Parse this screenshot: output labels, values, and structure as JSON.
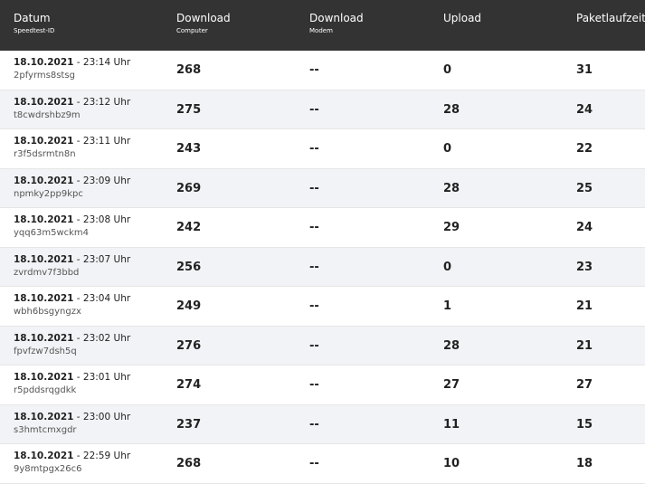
{
  "header": {
    "date": {
      "main": "Datum",
      "sub": "Speedtest-ID"
    },
    "download_computer": {
      "main": "Download",
      "sub": "Computer"
    },
    "download_modem": {
      "main": "Download",
      "sub": "Modem"
    },
    "upload": {
      "main": "Upload"
    },
    "latency": {
      "main": "Paketlaufzeit"
    }
  },
  "rows": [
    {
      "date": "18.10.2021",
      "time": "- 23:14 Uhr",
      "id": "2pfyrms8stsg",
      "download_computer": "268",
      "download_modem": "--",
      "upload": "0",
      "latency": "31"
    },
    {
      "date": "18.10.2021",
      "time": "- 23:12 Uhr",
      "id": "t8cwdrshbz9m",
      "download_computer": "275",
      "download_modem": "--",
      "upload": "28",
      "latency": "24"
    },
    {
      "date": "18.10.2021",
      "time": "- 23:11 Uhr",
      "id": "r3f5dsrmtn8n",
      "download_computer": "243",
      "download_modem": "--",
      "upload": "0",
      "latency": "22"
    },
    {
      "date": "18.10.2021",
      "time": "- 23:09 Uhr",
      "id": "npmky2pp9kpc",
      "download_computer": "269",
      "download_modem": "--",
      "upload": "28",
      "latency": "25"
    },
    {
      "date": "18.10.2021",
      "time": "- 23:08 Uhr",
      "id": "yqq63m5wckm4",
      "download_computer": "242",
      "download_modem": "--",
      "upload": "29",
      "latency": "24"
    },
    {
      "date": "18.10.2021",
      "time": "- 23:07 Uhr",
      "id": "zvrdmv7f3bbd",
      "download_computer": "256",
      "download_modem": "--",
      "upload": "0",
      "latency": "23"
    },
    {
      "date": "18.10.2021",
      "time": "- 23:04 Uhr",
      "id": "wbh6bsgyngzx",
      "download_computer": "249",
      "download_modem": "--",
      "upload": "1",
      "latency": "21"
    },
    {
      "date": "18.10.2021",
      "time": "- 23:02 Uhr",
      "id": "fpvfzw7dsh5q",
      "download_computer": "276",
      "download_modem": "--",
      "upload": "28",
      "latency": "21"
    },
    {
      "date": "18.10.2021",
      "time": "- 23:01 Uhr",
      "id": "r5pddsrqgdkk",
      "download_computer": "274",
      "download_modem": "--",
      "upload": "27",
      "latency": "27"
    },
    {
      "date": "18.10.2021",
      "time": "- 23:00 Uhr",
      "id": "s3hmtcmxgdr",
      "download_computer": "237",
      "download_modem": "--",
      "upload": "11",
      "latency": "15"
    },
    {
      "date": "18.10.2021",
      "time": "- 22:59 Uhr",
      "id": "9y8mtpgx26c6",
      "download_computer": "268",
      "download_modem": "--",
      "upload": "10",
      "latency": "18"
    }
  ]
}
